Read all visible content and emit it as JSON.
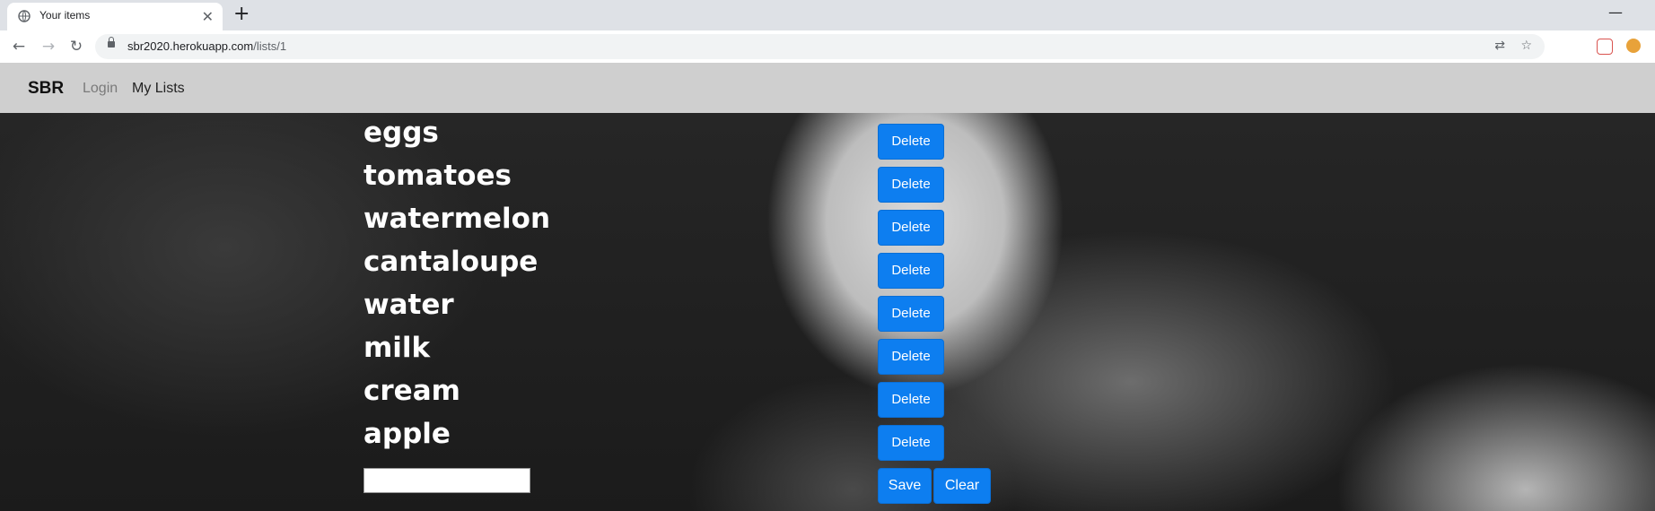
{
  "browser": {
    "tab_title": "Your items",
    "url_host": "sbr2020.herokuapp.com",
    "url_path": "/lists/1",
    "new_tab_symbol": "+",
    "close_tab_symbol": "✕",
    "minimize_symbol": "—"
  },
  "navbar": {
    "brand": "SBR",
    "links": [
      "Login",
      "My Lists"
    ]
  },
  "list": {
    "items": [
      "eggs",
      "tomatoes",
      "watermelon",
      "cantaloupe",
      "water",
      "milk",
      "cream",
      "apple"
    ],
    "delete_label": "Delete",
    "new_item_value": "",
    "save_label": "Save",
    "clear_label": "Clear"
  },
  "colors": {
    "button_blue": "#0d7ef0",
    "navbar_bg": "#cfcfcf"
  }
}
